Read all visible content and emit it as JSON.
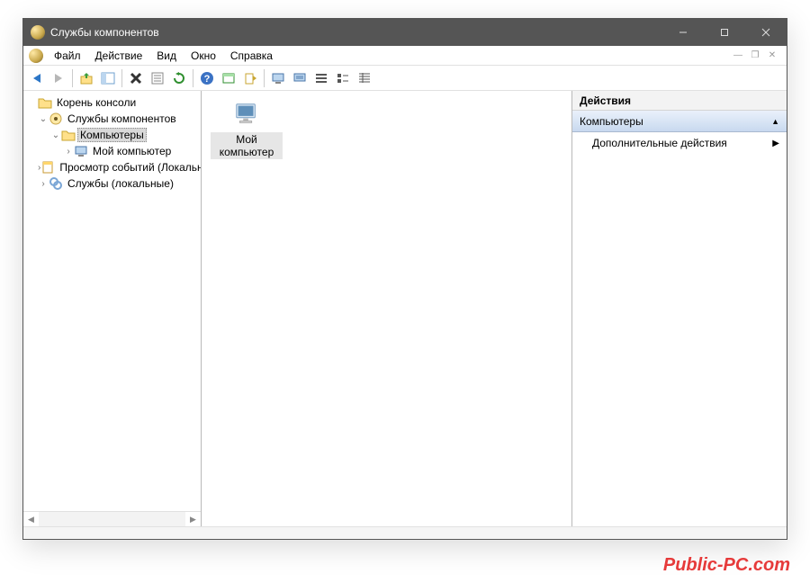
{
  "window": {
    "title": "Службы компонентов"
  },
  "menubar": {
    "items": [
      "Файл",
      "Действие",
      "Вид",
      "Окно",
      "Справка"
    ]
  },
  "tree": {
    "root": "Корень консоли",
    "component_services": "Службы компонентов",
    "computers": "Компьютеры",
    "my_computer": "Мой компьютер",
    "event_viewer": "Просмотр событий (Локальный)",
    "local_services": "Службы (локальные)"
  },
  "content": {
    "item1_line1": "Мой",
    "item1_line2": "компьютер"
  },
  "actions": {
    "header": "Действия",
    "section": "Компьютеры",
    "more": "Дополнительные действия"
  },
  "watermark": "Public-PC.com"
}
